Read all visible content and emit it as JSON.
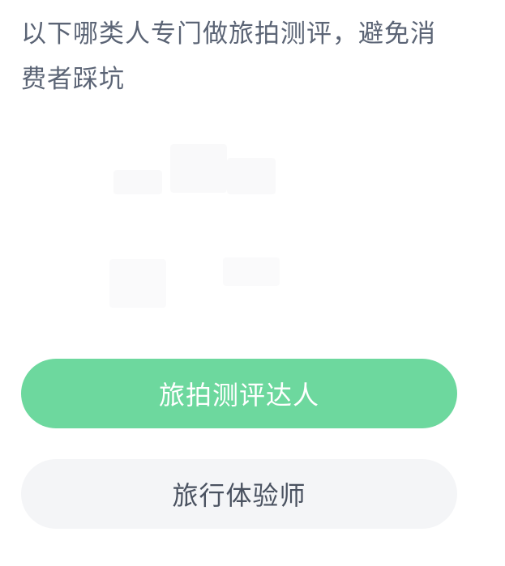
{
  "question": {
    "text": "以下哪类人专门做旅拍测评，避免消费者踩坑"
  },
  "options": [
    {
      "label": "旅拍测评达人",
      "state": "selected-correct",
      "color": "#6dd89e"
    },
    {
      "label": "旅行体验师",
      "state": "unselected",
      "color": "#f4f5f7"
    }
  ]
}
